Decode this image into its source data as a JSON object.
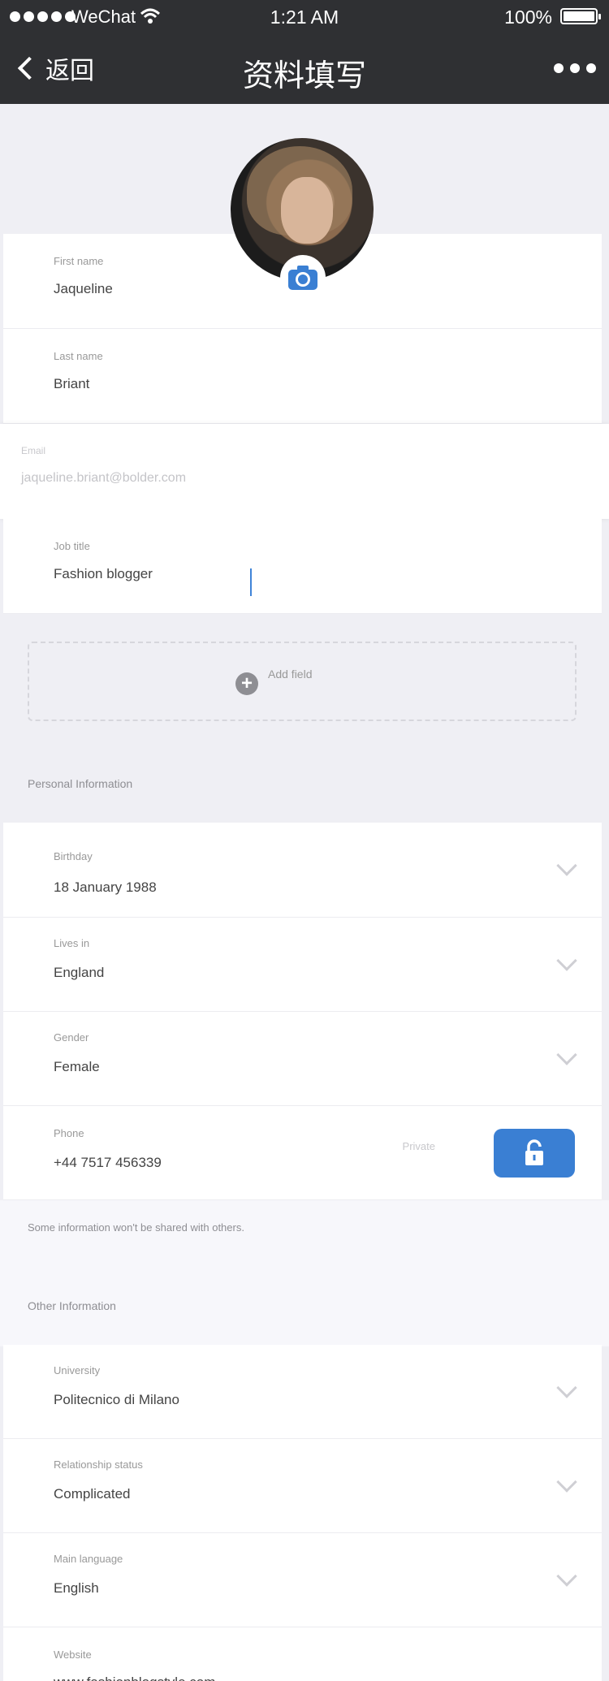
{
  "status_bar": {
    "carrier": "WeChat",
    "time": "1:21 AM",
    "battery": "100%"
  },
  "nav": {
    "back_label": "返回",
    "title": "资料填写"
  },
  "fields": {
    "first_name": {
      "label": "First name",
      "value": "Jaqueline"
    },
    "last_name": {
      "label": "Last name",
      "value": "Briant"
    },
    "email": {
      "label": "Email",
      "placeholder": "jaqueline.briant@bolder.com"
    },
    "job_title": {
      "label": "Job title",
      "value": "Fashion blogger"
    }
  },
  "add_field_label": "Add field",
  "sections": {
    "personal": "Personal Information",
    "other": "Other Information"
  },
  "personal": {
    "birthday": {
      "label": "Birthday",
      "value": "18 January 1988"
    },
    "lives_in": {
      "label": "Lives in",
      "value": "England"
    },
    "gender": {
      "label": "Gender",
      "value": "Female"
    },
    "phone": {
      "label": "Phone",
      "value": "+44 7517 456339",
      "private_label": "Private"
    }
  },
  "privacy_note": "Some information won't be shared with others.",
  "other": {
    "university": {
      "label": "University",
      "value": "Politecnico di Milano"
    },
    "relationship": {
      "label": "Relationship status",
      "value": "Complicated"
    },
    "language": {
      "label": "Main language",
      "value": "English"
    },
    "website": {
      "label": "Website",
      "value": "www.fashionblogstyle.com"
    }
  },
  "colors": {
    "accent": "#3a7fd3",
    "navbar": "#2f3033",
    "background": "#efeff4"
  }
}
